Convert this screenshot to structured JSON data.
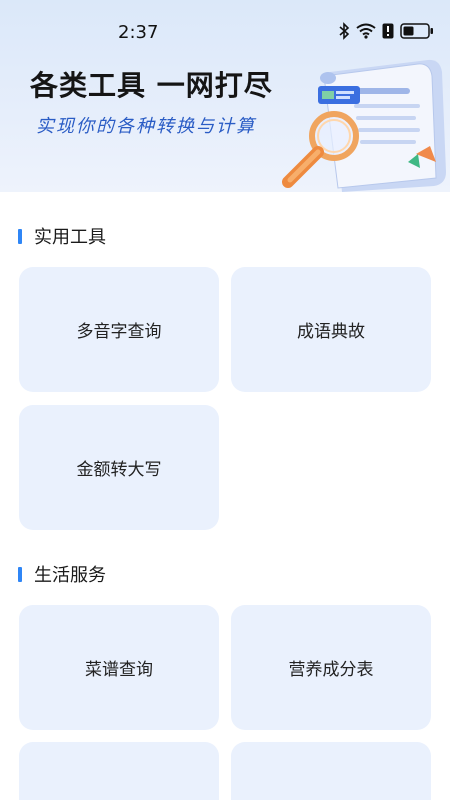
{
  "status_bar": {
    "time": "2:37",
    "icons": [
      "bluetooth-icon",
      "wifi-icon",
      "alert-icon",
      "battery-icon"
    ]
  },
  "hero": {
    "title": "各类工具 一网打尽",
    "subtitle": "实现你的各种转换与计算",
    "illustration": "document-magnifier-illustration"
  },
  "sections": [
    {
      "title": "实用工具",
      "items": [
        {
          "label": "多音字查询"
        },
        {
          "label": "成语典故"
        },
        {
          "label": "金额转大写"
        }
      ]
    },
    {
      "title": "生活服务",
      "items": [
        {
          "label": "菜谱查询"
        },
        {
          "label": "营养成分表"
        },
        {
          "label": ""
        },
        {
          "label": ""
        }
      ]
    }
  ],
  "colors": {
    "accent": "#2f86f6",
    "card_bg": "#eaf1fd",
    "subtitle": "#2a5cc5",
    "hero_bg": "#dbe8f9"
  }
}
